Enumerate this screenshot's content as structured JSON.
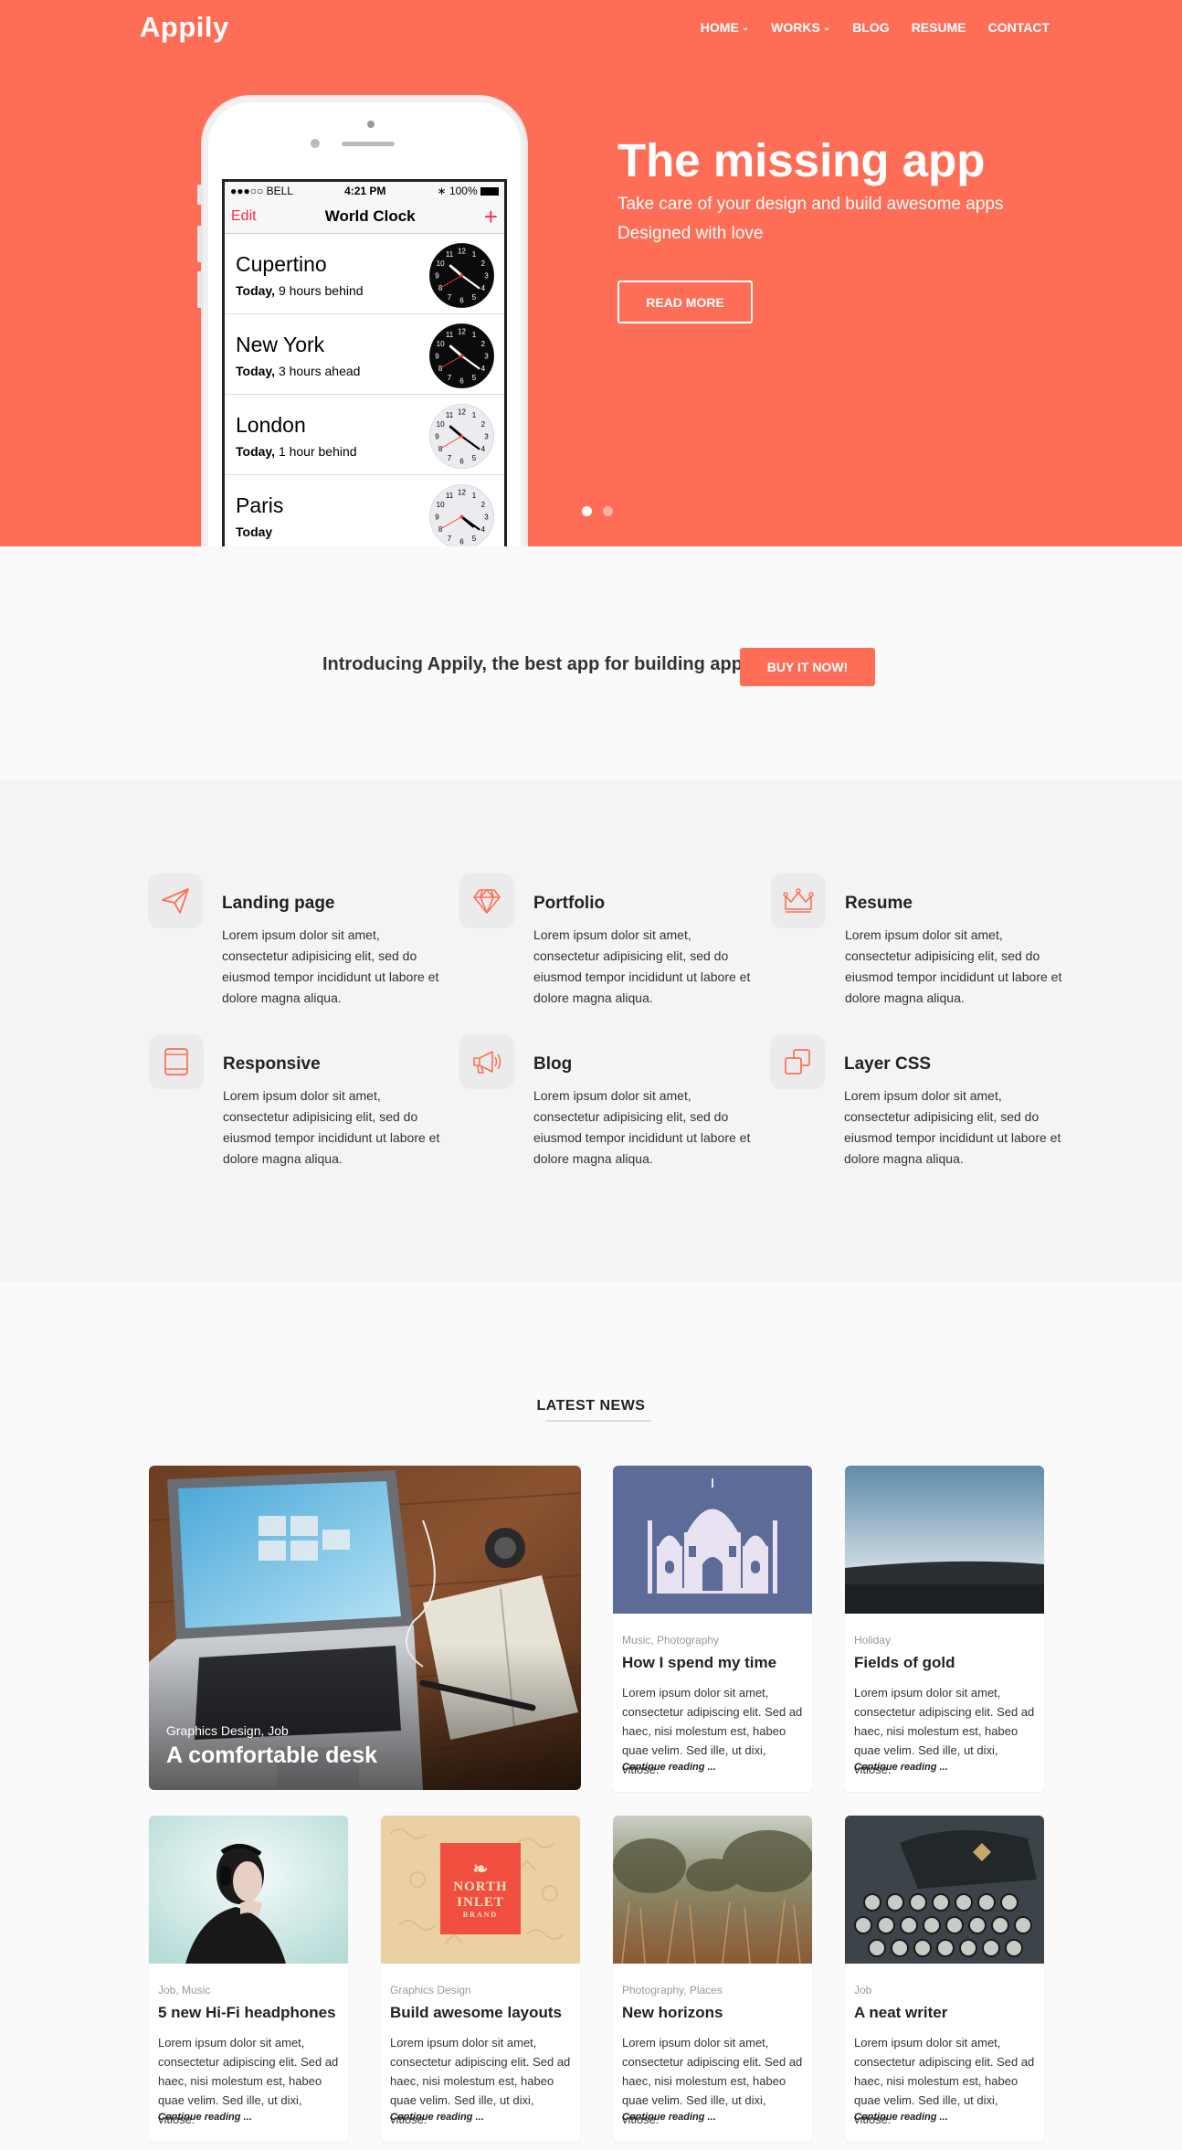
{
  "brand": {
    "name": "Appily",
    "accent": "#fe6e57"
  },
  "nav": [
    {
      "label": "HOME",
      "dropdown": true
    },
    {
      "label": "WORKS",
      "dropdown": true
    },
    {
      "label": "BLOG",
      "dropdown": false
    },
    {
      "label": "RESUME",
      "dropdown": false
    },
    {
      "label": "CONTACT",
      "dropdown": false
    }
  ],
  "hero": {
    "title": "The missing app",
    "subtitle_line1": "Take care of your design and build awesome apps",
    "subtitle_line2": "Designed with love",
    "button": "READ MORE",
    "slides": 2,
    "active_slide": 1
  },
  "phone": {
    "status_left": "●●●○○ BELL",
    "status_time": "4:21 PM",
    "status_battery": "100%",
    "edit": "Edit",
    "title": "World Clock",
    "plus": "+",
    "clocks": [
      {
        "city": "Cupertino",
        "day": "Today,",
        "offset": "9 hours behind",
        "dark": true
      },
      {
        "city": "New York",
        "day": "Today,",
        "offset": "3 hours ahead",
        "dark": true
      },
      {
        "city": "London",
        "day": "Today,",
        "offset": "1 hour behind",
        "dark": false
      },
      {
        "city": "Paris",
        "day": "Today",
        "offset": "",
        "dark": false
      }
    ]
  },
  "intro": {
    "text": "Introducing Appily, the best app for building apps",
    "button": "BUY IT NOW!"
  },
  "features": [
    {
      "icon": "paper-plane-icon",
      "title": "Landing page",
      "text": "Lorem ipsum dolor sit amet, consectetur adipisicing elit, sed do eiusmod tempor incididunt ut labore et dolore magna aliqua."
    },
    {
      "icon": "diamond-icon",
      "title": "Portfolio",
      "text": "Lorem ipsum dolor sit amet, consectetur adipisicing elit, sed do eiusmod tempor incididunt ut labore et dolore magna aliqua."
    },
    {
      "icon": "crown-icon",
      "title": "Resume",
      "text": "Lorem ipsum dolor sit amet, consectetur adipisicing elit, sed do eiusmod tempor incididunt ut labore et dolore magna aliqua."
    },
    {
      "icon": "tablet-icon",
      "title": "Responsive",
      "text": "Lorem ipsum dolor sit amet, consectetur adipisicing elit, sed do eiusmod tempor incididunt ut labore et dolore magna aliqua."
    },
    {
      "icon": "megaphone-icon",
      "title": "Blog",
      "text": "Lorem ipsum dolor sit amet, consectetur adipisicing elit, sed do eiusmod tempor incididunt ut labore et dolore magna aliqua."
    },
    {
      "icon": "layers-icon",
      "title": "Layer CSS",
      "text": "Lorem ipsum dolor sit amet, consectetur adipisicing elit, sed do eiusmod tempor incididunt ut labore et dolore magna aliqua."
    }
  ],
  "news": {
    "heading": "LATEST NEWS",
    "featured": {
      "category": "Graphics Design, Job",
      "title": "A comfortable desk"
    },
    "more_label": "Continue reading ...",
    "cards": [
      {
        "category": "Music, Photography",
        "title": "How I spend my time",
        "text": "Lorem ipsum dolor sit amet, consectetur adipiscing elit. Sed ad haec, nisi molestum est, habeo quae velim. Sed ille, ut dixi, vitiose."
      },
      {
        "category": "Holiday",
        "title": "Fields of gold",
        "text": "Lorem ipsum dolor sit amet, consectetur adipiscing elit. Sed ad haec, nisi molestum est, habeo quae velim. Sed ille, ut dixi, vitiose."
      },
      {
        "category": "Job, Music",
        "title": "5 new Hi-Fi headphones",
        "text": "Lorem ipsum dolor sit amet, consectetur adipiscing elit. Sed ad haec, nisi molestum est, habeo quae velim. Sed ille, ut dixi, vitiose."
      },
      {
        "category": "Graphics Design",
        "title": "Build awesome layouts",
        "text": "Lorem ipsum dolor sit amet, consectetur adipiscing elit. Sed ad haec, nisi molestum est, habeo quae velim. Sed ille, ut dixi, vitiose."
      },
      {
        "category": "Photography, Places",
        "title": "New horizons",
        "text": "Lorem ipsum dolor sit amet, consectetur adipiscing elit. Sed ad haec, nisi molestum est, habeo quae velim. Sed ille, ut dixi, vitiose."
      },
      {
        "category": "Job",
        "title": "A neat writer",
        "text": "Lorem ipsum dolor sit amet, consectetur adipiscing elit. Sed ad haec, nisi molestum est, habeo quae velim. Sed ille, ut dixi, vitiose."
      }
    ],
    "logo_badge": {
      "line1": "NORTH",
      "line2": "INLET",
      "line3": "BRAND"
    }
  }
}
